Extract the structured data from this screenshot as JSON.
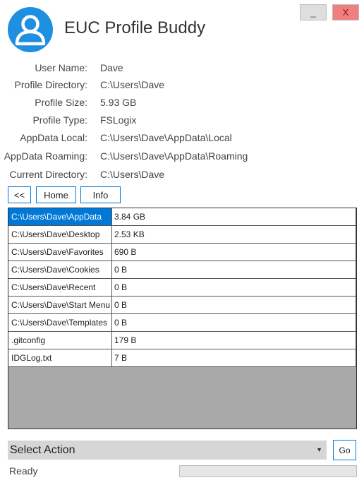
{
  "app": {
    "title": "EUC Profile Buddy"
  },
  "window": {
    "minimize_label": "_",
    "close_label": "X"
  },
  "profile": [
    {
      "label": "User Name:",
      "value": "Dave"
    },
    {
      "label": "Profile Directory:",
      "value": "C:\\Users\\Dave"
    },
    {
      "label": "Profile Size:",
      "value": "5.93 GB"
    },
    {
      "label": "Profile Type:",
      "value": "FSLogix"
    },
    {
      "label": "AppData Local:",
      "value": "C:\\Users\\Dave\\AppData\\Local"
    },
    {
      "label": "AppData Roaming:",
      "value": "C:\\Users\\Dave\\AppData\\Roaming"
    },
    {
      "label": "Current Directory:",
      "value": "C:\\Users\\Dave"
    }
  ],
  "nav": {
    "back_label": "<<",
    "home_label": "Home",
    "info_label": "Info"
  },
  "files": [
    {
      "name": "C:\\Users\\Dave\\AppData",
      "size": "3.84 GB",
      "selected": true
    },
    {
      "name": "C:\\Users\\Dave\\Desktop",
      "size": "2.53 KB"
    },
    {
      "name": "C:\\Users\\Dave\\Favorites",
      "size": "690 B"
    },
    {
      "name": "C:\\Users\\Dave\\Cookies",
      "size": "0 B"
    },
    {
      "name": "C:\\Users\\Dave\\Recent",
      "size": "0 B"
    },
    {
      "name": "C:\\Users\\Dave\\Start Menu",
      "size": "0 B"
    },
    {
      "name": "C:\\Users\\Dave\\Templates",
      "size": "0 B"
    },
    {
      "name": ".gitconfig",
      "size": "179 B"
    },
    {
      "name": "IDGLog.txt",
      "size": "7 B"
    }
  ],
  "action": {
    "selected": "Select Action",
    "go_label": "Go"
  },
  "status": {
    "text": "Ready",
    "progress": 0
  },
  "colors": {
    "accent": "#0078d7",
    "avatar": "#1e8fe1",
    "close": "#f08080",
    "grid_empty": "#a9a9a9"
  }
}
